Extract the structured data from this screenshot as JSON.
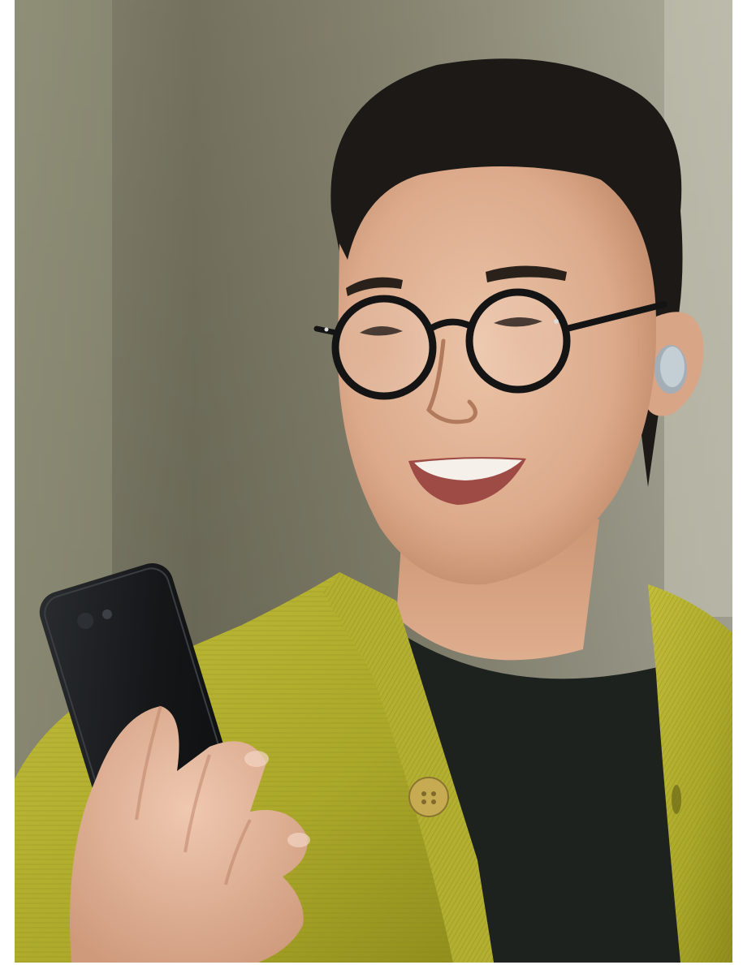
{
  "photo": {
    "subject": "person-with-phone",
    "colors": {
      "background_light": "#b9b6a3",
      "background_dark": "#6f6c58",
      "skin": "#e2b69a",
      "skin_shadow": "#c48d6d",
      "hair": "#1c1916",
      "cardigan": "#b8b530",
      "cardigan_shadow": "#8d8a1c",
      "shirt": "#1f2420",
      "phone": "#16181a",
      "earbud": "#b6c0c8",
      "glasses": "#141414"
    },
    "icons": [
      "glasses-icon",
      "earbud-icon",
      "phone-icon",
      "button-icon"
    ]
  }
}
